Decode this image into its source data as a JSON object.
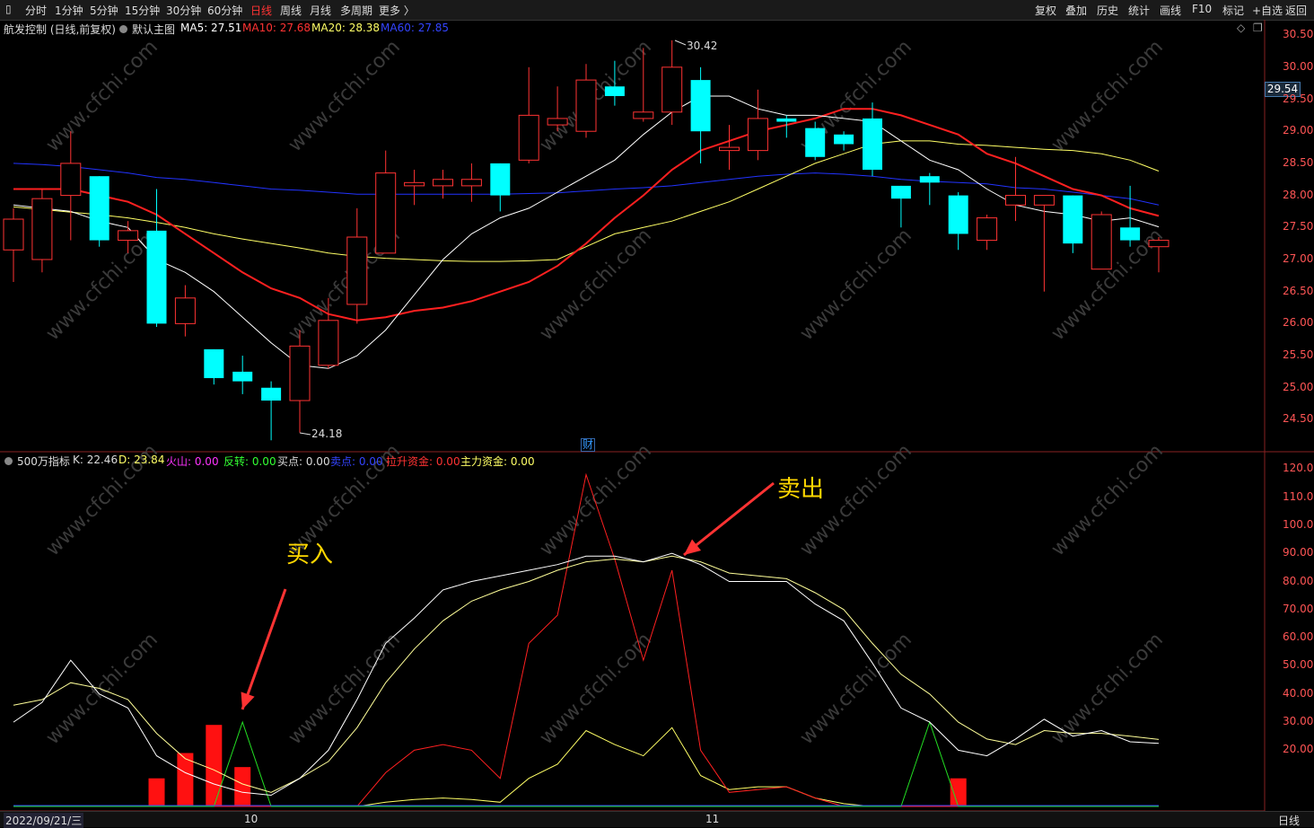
{
  "toolbar": {
    "periods": [
      "分时",
      "1分钟",
      "5分钟",
      "15分钟",
      "30分钟",
      "60分钟",
      "日线",
      "周线",
      "月线",
      "多周期",
      "更多 〉"
    ],
    "active_period": "日线",
    "right_items": [
      "复权",
      "叠加",
      "历史",
      "统计",
      "画线",
      "F10",
      "标记",
      "+自选",
      "返回"
    ]
  },
  "main_panel": {
    "stock": "航发控制 (日线,前复权)",
    "template": "默认主图",
    "ma5": "MA5: 27.51",
    "ma10": "MA10: 27.68",
    "ma20": "MA20: 28.38",
    "ma60": "MA60: 27.85",
    "high_label": "30.42",
    "low_label": "24.18",
    "current_price": "29.54",
    "finance_marker": "财",
    "y_labels": [
      "30.50",
      "30.00",
      "29.50",
      "29.00",
      "28.50",
      "28.00",
      "27.50",
      "27.00",
      "26.50",
      "26.00",
      "25.50",
      "25.00",
      "24.50"
    ]
  },
  "sub_panel": {
    "name": "500万指标",
    "k": "K: 22.46",
    "d": "D: 23.84",
    "huoshan": "火山: 0.00",
    "fanzhuan": "反转: 0.00",
    "buy_pt": "买点: 0.00",
    "sell_pt": "卖点: 0.00",
    "lasheng": "拉升资金: 0.00",
    "zhuli": "主力资金: 0.00",
    "y_labels": [
      "120.0",
      "110.0",
      "100.0",
      "90.00",
      "80.00",
      "70.00",
      "60.00",
      "50.00",
      "40.00",
      "30.00",
      "20.00"
    ]
  },
  "annotations": {
    "buy": "买入",
    "sell": "卖出"
  },
  "bottom": {
    "date": "2022/09/21/三",
    "month10": "10",
    "month11": "11",
    "period": "日线"
  },
  "watermark": "www.cfchi.com",
  "colors": {
    "up": "#ff3333",
    "down": "#00ffff",
    "ma5": "#ffffff",
    "ma10": "#ff2020",
    "ma20": "#ffff66",
    "ma60": "#2233ff"
  },
  "chart_data": {
    "type": "candlestick",
    "candles": [
      {
        "o": 27.15,
        "h": 27.8,
        "l": 26.65,
        "c": 27.63
      },
      {
        "o": 27.0,
        "h": 28.1,
        "l": 26.8,
        "c": 27.95
      },
      {
        "o": 28.0,
        "h": 29.0,
        "l": 27.3,
        "c": 28.5
      },
      {
        "o": 28.3,
        "h": 28.3,
        "l": 27.2,
        "c": 27.3
      },
      {
        "o": 27.3,
        "h": 27.6,
        "l": 27.1,
        "c": 27.45
      },
      {
        "o": 27.45,
        "h": 28.1,
        "l": 25.95,
        "c": 26.0
      },
      {
        "o": 26.0,
        "h": 26.6,
        "l": 25.8,
        "c": 26.4
      },
      {
        "o": 25.6,
        "h": 25.6,
        "l": 25.05,
        "c": 25.15
      },
      {
        "o": 25.25,
        "h": 25.5,
        "l": 24.9,
        "c": 25.1
      },
      {
        "o": 25.0,
        "h": 25.1,
        "l": 24.18,
        "c": 24.8
      },
      {
        "o": 24.8,
        "h": 25.9,
        "l": 24.3,
        "c": 25.65
      },
      {
        "o": 25.35,
        "h": 26.4,
        "l": 25.3,
        "c": 26.05
      },
      {
        "o": 26.3,
        "h": 27.8,
        "l": 26.0,
        "c": 27.35
      },
      {
        "o": 27.1,
        "h": 28.7,
        "l": 27.1,
        "c": 28.35
      },
      {
        "o": 28.15,
        "h": 28.4,
        "l": 27.85,
        "c": 28.2
      },
      {
        "o": 28.15,
        "h": 28.4,
        "l": 27.95,
        "c": 28.25
      },
      {
        "o": 28.15,
        "h": 28.5,
        "l": 27.9,
        "c": 28.25
      },
      {
        "o": 28.5,
        "h": 28.5,
        "l": 27.75,
        "c": 28.0
      },
      {
        "o": 28.55,
        "h": 30.0,
        "l": 28.5,
        "c": 29.25
      },
      {
        "o": 29.1,
        "h": 29.7,
        "l": 29.0,
        "c": 29.2
      },
      {
        "o": 29.0,
        "h": 30.05,
        "l": 28.9,
        "c": 29.8
      },
      {
        "o": 29.7,
        "h": 30.1,
        "l": 29.4,
        "c": 29.55
      },
      {
        "o": 29.2,
        "h": 30.3,
        "l": 29.15,
        "c": 29.3
      },
      {
        "o": 29.3,
        "h": 30.42,
        "l": 29.1,
        "c": 30.0
      },
      {
        "o": 29.8,
        "h": 30.0,
        "l": 28.5,
        "c": 29.0
      },
      {
        "o": 28.7,
        "h": 29.1,
        "l": 28.4,
        "c": 28.75
      },
      {
        "o": 28.7,
        "h": 29.65,
        "l": 28.55,
        "c": 29.2
      },
      {
        "o": 29.2,
        "h": 29.25,
        "l": 28.9,
        "c": 29.15
      },
      {
        "o": 29.05,
        "h": 29.15,
        "l": 28.55,
        "c": 28.6
      },
      {
        "o": 28.95,
        "h": 29.0,
        "l": 28.7,
        "c": 28.8
      },
      {
        "o": 29.2,
        "h": 29.45,
        "l": 28.3,
        "c": 28.4
      },
      {
        "o": 28.15,
        "h": 28.15,
        "l": 27.5,
        "c": 27.95
      },
      {
        "o": 28.3,
        "h": 28.35,
        "l": 27.85,
        "c": 28.2
      },
      {
        "o": 28.0,
        "h": 28.05,
        "l": 27.15,
        "c": 27.4
      },
      {
        "o": 27.3,
        "h": 27.7,
        "l": 27.15,
        "c": 27.65
      },
      {
        "o": 27.85,
        "h": 28.6,
        "l": 27.6,
        "c": 28.0
      },
      {
        "o": 27.85,
        "h": 28.0,
        "l": 26.5,
        "c": 28.0
      },
      {
        "o": 28.0,
        "h": 28.0,
        "l": 27.1,
        "c": 27.25
      },
      {
        "o": 26.85,
        "h": 27.75,
        "l": 26.85,
        "c": 27.7
      },
      {
        "o": 27.5,
        "h": 28.15,
        "l": 27.2,
        "c": 27.3
      },
      {
        "o": 27.2,
        "h": 27.35,
        "l": 26.8,
        "c": 27.3
      }
    ],
    "ma5": [
      27.85,
      27.8,
      27.75,
      27.6,
      27.5,
      27.0,
      26.8,
      26.5,
      26.1,
      25.7,
      25.35,
      25.3,
      25.5,
      25.9,
      26.45,
      27.0,
      27.4,
      27.65,
      27.8,
      28.05,
      28.3,
      28.55,
      28.95,
      29.3,
      29.55,
      29.55,
      29.35,
      29.25,
      29.25,
      29.2,
      29.15,
      28.85,
      28.55,
      28.4,
      28.1,
      27.85,
      27.75,
      27.7,
      27.6,
      27.65,
      27.51
    ],
    "ma10": [
      28.1,
      28.1,
      28.1,
      28.0,
      27.9,
      27.7,
      27.4,
      27.1,
      26.8,
      26.55,
      26.4,
      26.15,
      26.05,
      26.1,
      26.2,
      26.25,
      26.35,
      26.5,
      26.65,
      26.9,
      27.25,
      27.65,
      28.0,
      28.4,
      28.7,
      28.85,
      29.0,
      29.1,
      29.2,
      29.35,
      29.35,
      29.25,
      29.1,
      28.95,
      28.65,
      28.5,
      28.3,
      28.1,
      28.0,
      27.8,
      27.68
    ],
    "ma20": [
      27.82,
      27.78,
      27.74,
      27.7,
      27.65,
      27.58,
      27.5,
      27.4,
      27.32,
      27.25,
      27.18,
      27.1,
      27.05,
      27.02,
      27.0,
      26.98,
      26.97,
      26.97,
      26.98,
      27.0,
      27.2,
      27.4,
      27.5,
      27.6,
      27.75,
      27.9,
      28.1,
      28.3,
      28.5,
      28.65,
      28.8,
      28.85,
      28.85,
      28.8,
      28.78,
      28.75,
      28.72,
      28.7,
      28.65,
      28.55,
      28.38
    ],
    "ma60": [
      28.5,
      28.48,
      28.45,
      28.4,
      28.35,
      28.28,
      28.25,
      28.2,
      28.15,
      28.1,
      28.08,
      28.05,
      28.02,
      28.02,
      28.02,
      28.02,
      28.02,
      28.02,
      28.03,
      28.04,
      28.07,
      28.1,
      28.12,
      28.15,
      28.2,
      28.25,
      28.3,
      28.33,
      28.35,
      28.33,
      28.3,
      28.25,
      28.22,
      28.2,
      28.18,
      28.12,
      28.1,
      28.05,
      28.0,
      27.95,
      27.85
    ],
    "k": [
      30,
      37,
      52,
      40,
      35,
      18,
      12,
      8,
      5,
      4,
      10,
      20,
      38,
      58,
      67,
      77,
      80,
      82,
      84,
      86,
      89,
      89,
      87,
      90,
      86,
      80,
      80,
      80,
      72,
      66,
      51,
      35,
      30,
      20,
      18,
      24,
      31,
      25,
      27,
      23,
      22.46
    ],
    "d": [
      36,
      38,
      44,
      42,
      38,
      26,
      17,
      13,
      8,
      5,
      10,
      16,
      28,
      44,
      56,
      66,
      73,
      77,
      80,
      84,
      87,
      88,
      87,
      89,
      87,
      83,
      82,
      81,
      76,
      70,
      58,
      47,
      40,
      30,
      24,
      22,
      27,
      26,
      26,
      25,
      23.84
    ],
    "lasheng": [
      0,
      0,
      0,
      0,
      0,
      0,
      0,
      0,
      0,
      0,
      0,
      0,
      0,
      12,
      20,
      22,
      20,
      10,
      58,
      68,
      118,
      88,
      52,
      84,
      20,
      5,
      6,
      7,
      3,
      0,
      0,
      0,
      0,
      0,
      0,
      0,
      0,
      0,
      0,
      0,
      0
    ],
    "zhuli": [
      0,
      0,
      0,
      0,
      0,
      0,
      0,
      0,
      0,
      0,
      0,
      0,
      0,
      1.5,
      2.5,
      3,
      2.5,
      1.5,
      10,
      15,
      27,
      22,
      18,
      28,
      11,
      6,
      7,
      7,
      3,
      1,
      0,
      0,
      0,
      0,
      0,
      0,
      0,
      0,
      0,
      0,
      0
    ],
    "fanzhuan": [
      0,
      0,
      0,
      0,
      0,
      0,
      0,
      0,
      30,
      0,
      0,
      0,
      0,
      0,
      0,
      0,
      0,
      0,
      0,
      0,
      0,
      0,
      0,
      0,
      0,
      0,
      0,
      0,
      0,
      0,
      0,
      0,
      30,
      0,
      0,
      0,
      0,
      0,
      0,
      0,
      0
    ],
    "bars": [
      0,
      0,
      0,
      0,
      0,
      10,
      19,
      29,
      14,
      0,
      0,
      0,
      0,
      0,
      0,
      0,
      0,
      0,
      0,
      0,
      0,
      0,
      0,
      0,
      0,
      0,
      0,
      0,
      0,
      0,
      0,
      0,
      0,
      10,
      0,
      0,
      0,
      0,
      0,
      0,
      0
    ],
    "price_range": [
      24.1,
      30.6
    ],
    "indicator_range": [
      0,
      122
    ]
  }
}
